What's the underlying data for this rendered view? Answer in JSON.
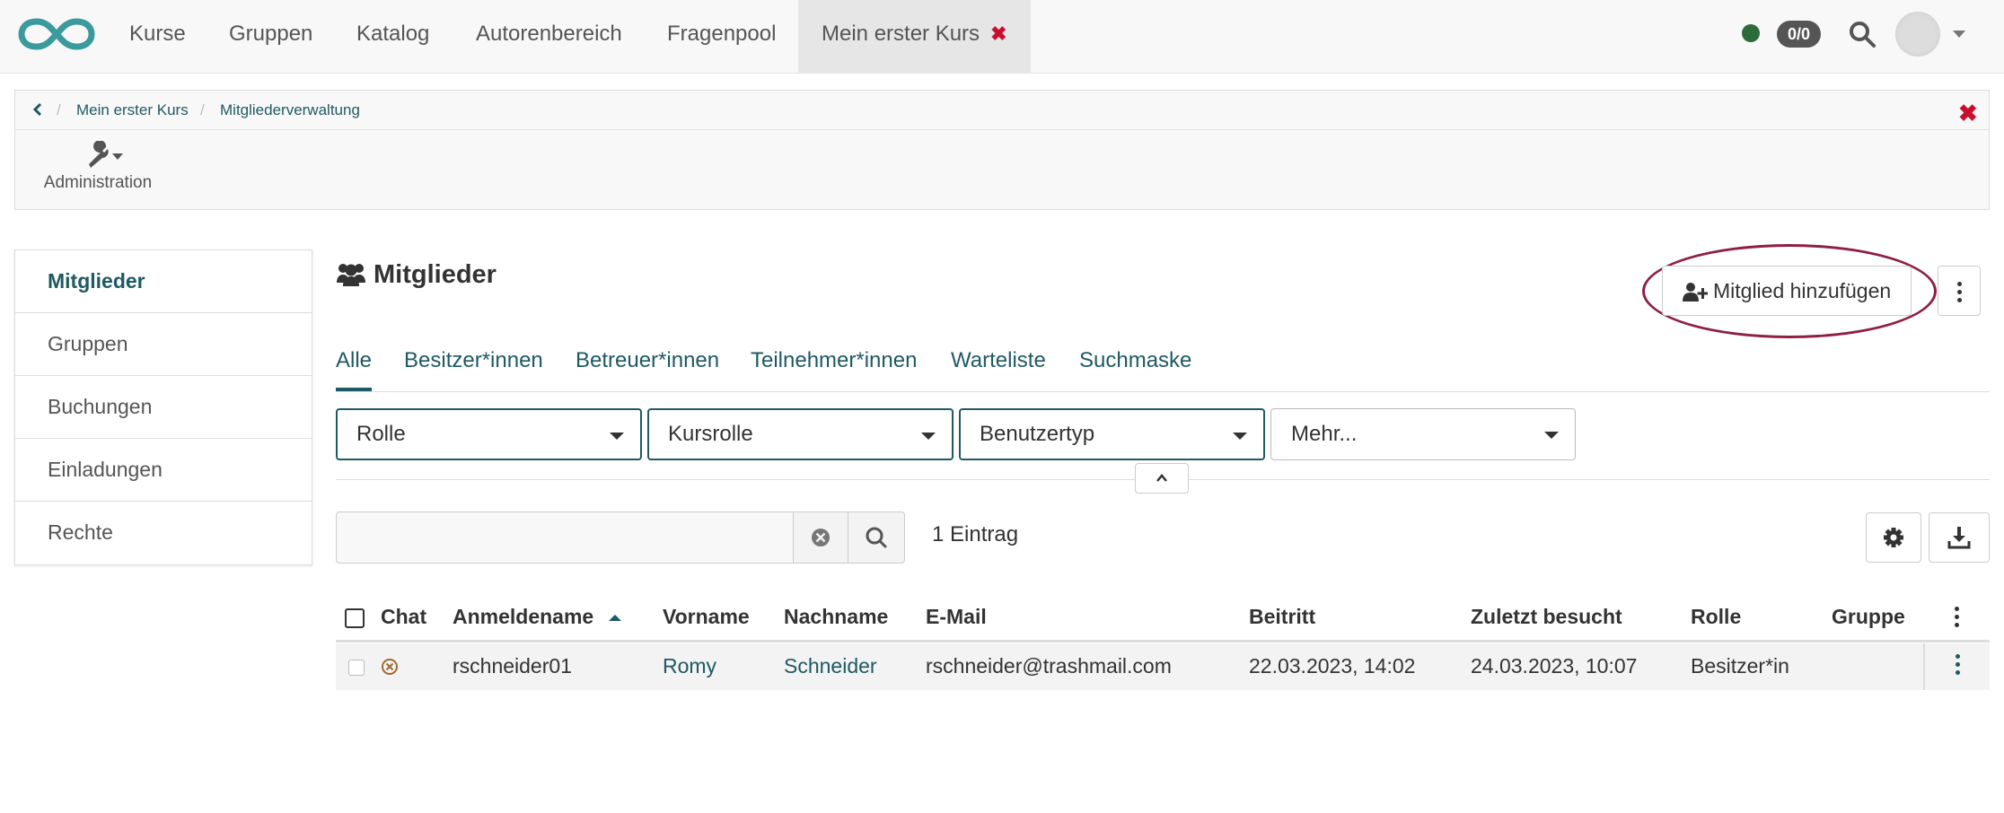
{
  "nav": {
    "items": [
      "Kurse",
      "Gruppen",
      "Katalog",
      "Autorenbereich",
      "Fragenpool"
    ],
    "active_tab": "Mein erster Kurs",
    "counter": "0/0"
  },
  "breadcrumb": {
    "items": [
      "Mein erster Kurs",
      "Mitgliederverwaltung"
    ]
  },
  "toolbar": {
    "admin_label": "Administration"
  },
  "leftmenu": {
    "items": [
      "Mitglieder",
      "Gruppen",
      "Buchungen",
      "Einladungen",
      "Rechte"
    ],
    "active": "Mitglieder"
  },
  "main": {
    "title": "Mitglieder",
    "add_button": "Mitglied hinzufügen",
    "tabs": [
      "Alle",
      "Besitzer*innen",
      "Betreuer*innen",
      "Teilnehmer*innen",
      "Warteliste",
      "Suchmaske"
    ],
    "active_tab": "Alle",
    "filters": [
      "Rolle",
      "Kursrolle",
      "Benutzertyp",
      "Mehr..."
    ],
    "search_value": "",
    "entry_count": "1 Eintrag"
  },
  "table": {
    "columns": [
      "Chat",
      "Anmeldename",
      "Vorname",
      "Nachname",
      "E-Mail",
      "Beitritt",
      "Zuletzt besucht",
      "Rolle",
      "Gruppe"
    ],
    "sorted_column": "Anmeldename",
    "rows": [
      {
        "login": "rschneider01",
        "firstname": "Romy",
        "lastname": "Schneider",
        "email": "rschneider@trashmail.com",
        "joined": "22.03.2023, 14:02",
        "last_visit": "24.03.2023, 10:07",
        "role": "Besitzer*in",
        "group": ""
      }
    ]
  },
  "colors": {
    "accent": "#1f5963",
    "logo": "#3a9a9c",
    "close": "#c8102e",
    "highlight": "#8e1f46",
    "status_online": "#2e6b3a"
  }
}
